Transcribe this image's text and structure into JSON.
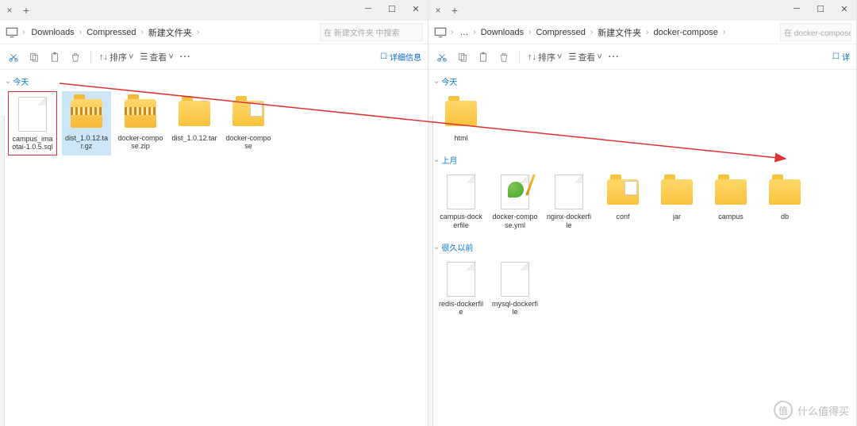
{
  "left": {
    "breadcrumbs": [
      "Downloads",
      "Compressed",
      "新建文件夹"
    ],
    "search_placeholder": "在 新建文件夹 中搜索",
    "toolbar": {
      "sort": "排序",
      "view": "查看",
      "details": "详细信息"
    },
    "sections": {
      "today": {
        "label": "今天",
        "items": [
          {
            "name": "campus_imaotai-1.0.5.sql",
            "icon": "file",
            "selected": true
          },
          {
            "name": "dist_1.0.12.tar.gz",
            "icon": "zip",
            "hl": true
          },
          {
            "name": "docker-compose.zip",
            "icon": "zip"
          },
          {
            "name": "dist_1.0.12.tar",
            "icon": "folder"
          },
          {
            "name": "docker-compose",
            "icon": "folder-doc"
          }
        ]
      }
    }
  },
  "right": {
    "breadcrumbs": [
      "…",
      "Downloads",
      "Compressed",
      "新建文件夹",
      "docker-compose"
    ],
    "search_placeholder": "在 docker-compose 中搜索",
    "toolbar": {
      "sort": "排序",
      "view": "查看",
      "details": "详"
    },
    "sections": {
      "today": {
        "label": "今天",
        "items": [
          {
            "name": "html",
            "icon": "folder"
          }
        ]
      },
      "last_month": {
        "label": "上月",
        "items": [
          {
            "name": "campus-dockerfile",
            "icon": "file"
          },
          {
            "name": "docker-compose.yml",
            "icon": "file-np"
          },
          {
            "name": "nginx-dockerfile",
            "icon": "file"
          },
          {
            "name": "conf",
            "icon": "folder-doc"
          },
          {
            "name": "jar",
            "icon": "folder"
          },
          {
            "name": "campus",
            "icon": "folder"
          },
          {
            "name": "db",
            "icon": "folder"
          }
        ]
      },
      "earlier": {
        "label": "很久以前",
        "items": [
          {
            "name": "redis-dockerfile",
            "icon": "file"
          },
          {
            "name": "mysql-dockerfile",
            "icon": "file"
          }
        ]
      }
    }
  },
  "watermark": "什么值得买"
}
